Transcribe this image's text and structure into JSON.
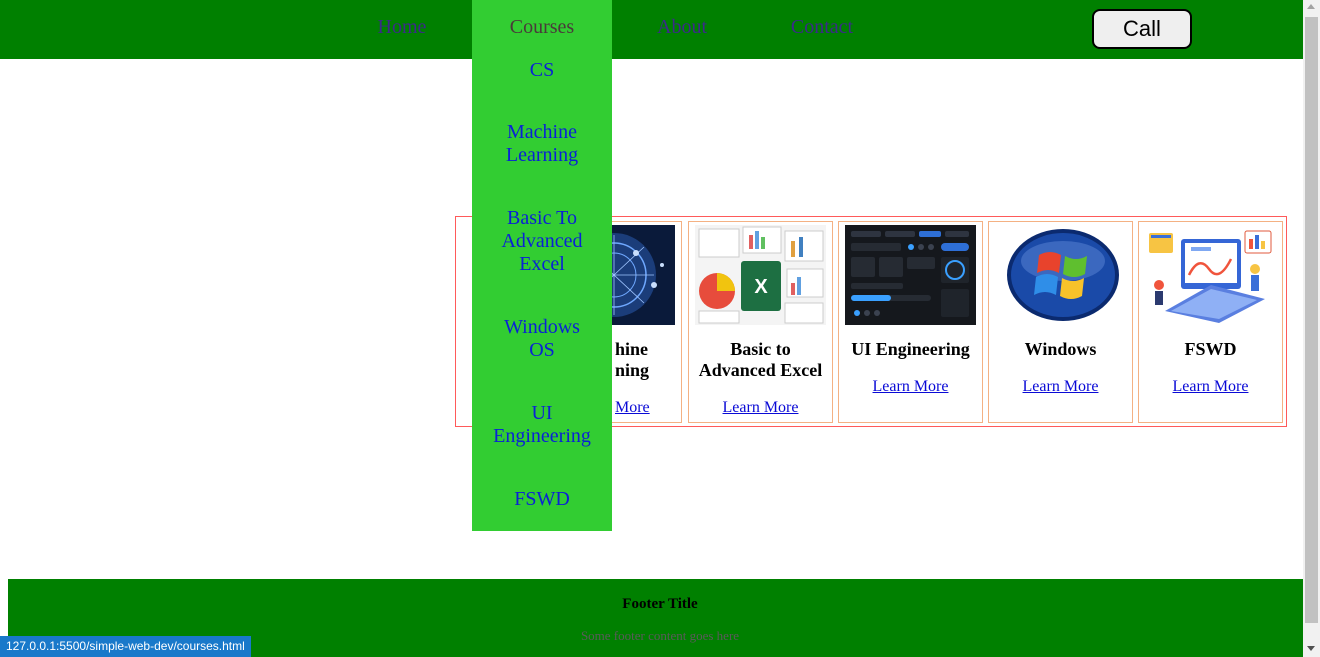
{
  "nav": {
    "items": [
      {
        "label": "Home"
      },
      {
        "label": "Courses"
      },
      {
        "label": "About"
      },
      {
        "label": "Contact"
      }
    ],
    "call_label": "Call"
  },
  "dropdown": {
    "items": [
      {
        "label": "CS"
      },
      {
        "label": "Machine Learning"
      },
      {
        "label": "Basic To Advanced Excel"
      },
      {
        "label": "Windows OS"
      },
      {
        "label": "UI Engineering"
      },
      {
        "label": "FSWD"
      }
    ]
  },
  "courses": [
    {
      "title": "Machine Learning",
      "visible_title": "hine ning",
      "link": "Learn More",
      "visible_link": "More",
      "image": "circuit-brain-image"
    },
    {
      "title": "Basic to Advanced Excel",
      "link": "Learn More",
      "image": "excel-collage-image"
    },
    {
      "title": "UI Engineering",
      "link": "Learn More",
      "image": "dark-ui-kit-image"
    },
    {
      "title": "Windows",
      "link": "Learn More",
      "image": "windows-logo-image"
    },
    {
      "title": "FSWD",
      "link": "Learn More",
      "image": "web-dev-illustration-image"
    }
  ],
  "footer": {
    "title": "Footer Title",
    "text": "Some footer content goes here"
  },
  "status_url": "127.0.0.1:5500/simple-web-dev/courses.html",
  "colors": {
    "header_bg": "#008000",
    "active_nav_bg": "#32cd32",
    "link": "#0a21d6",
    "card_border": "#f4b183",
    "cards_border": "#ff5a5a",
    "footer_bg": "#008000",
    "status_bg": "#1979ca"
  }
}
